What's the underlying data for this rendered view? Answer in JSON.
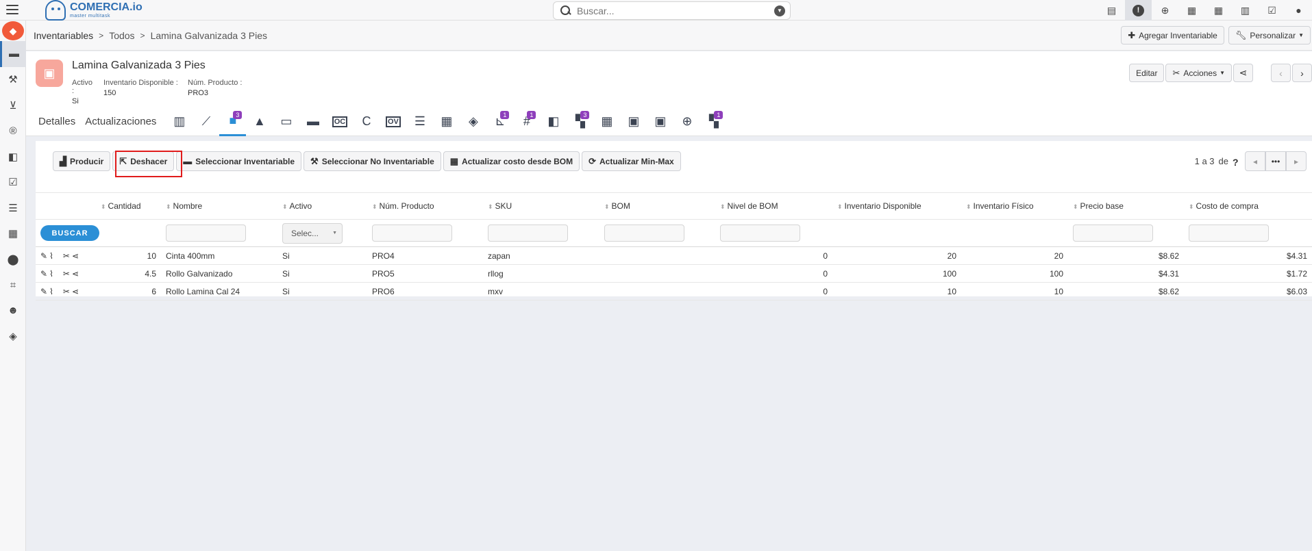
{
  "app": {
    "brand": "COMERCIA.io",
    "tagline": "master multitask"
  },
  "search": {
    "placeholder": "Buscar..."
  },
  "top_icons": [
    "cash-register-icon",
    "alert-icon",
    "plus-circle-icon",
    "calendar-check-icon",
    "calendar-icon",
    "chart-icon",
    "checkbox-icon",
    "user-icon"
  ],
  "sidebar": {
    "items": [
      "boxes-icon",
      "hammer-icon",
      "cart-icon",
      "registered-icon",
      "swatches-icon",
      "checkbox-icon",
      "list-icon",
      "calculator-icon",
      "map-pin-icon",
      "vector-icon",
      "users-icon",
      "cube-icon"
    ]
  },
  "breadcrumb": {
    "items": [
      "Inventariables",
      "Todos",
      "Lamina Galvanizada 3 Pies"
    ]
  },
  "crumb_actions": {
    "add": "Agregar Inventariable",
    "customize": "Personalizar"
  },
  "record": {
    "title": "Lamina Galvanizada 3 Pies",
    "fields": [
      {
        "label": "Activo :",
        "value": "Si"
      },
      {
        "label": "Inventario Disponible :",
        "value": "150"
      },
      {
        "label": "Núm. Producto :",
        "value": "PRO3"
      }
    ],
    "actions": {
      "edit": "Editar",
      "actions": "Acciones"
    }
  },
  "tabs": {
    "text": [
      "Detalles",
      "Actualizaciones"
    ],
    "icons": [
      {
        "name": "bar-chart-icon",
        "glyph": "▥",
        "badge": ""
      },
      {
        "name": "line-chart-icon",
        "glyph": "⟋",
        "badge": ""
      },
      {
        "name": "boxes-icon",
        "glyph": "■",
        "badge": "3",
        "active": true
      },
      {
        "name": "shapes-icon",
        "glyph": "▲",
        "badge": ""
      },
      {
        "name": "ticket-icon",
        "glyph": "▭",
        "badge": ""
      },
      {
        "name": "folder-icon",
        "glyph": "▬",
        "badge": ""
      },
      {
        "name": "oc-icon",
        "glyph": "OC",
        "badge": ""
      },
      {
        "name": "c-doc-icon",
        "glyph": "C",
        "badge": ""
      },
      {
        "name": "ov-icon",
        "glyph": "OV",
        "badge": ""
      },
      {
        "name": "list-icon",
        "glyph": "☰",
        "badge": ""
      },
      {
        "name": "calculator-icon",
        "glyph": "▦",
        "badge": ""
      },
      {
        "name": "box-open-icon",
        "glyph": "◈",
        "badge": ""
      },
      {
        "name": "dolly-icon",
        "glyph": "⊾",
        "badge": "1"
      },
      {
        "name": "hashtag-icon",
        "glyph": "#",
        "badge": "1"
      },
      {
        "name": "swatches-icon",
        "glyph": "◧",
        "badge": ""
      },
      {
        "name": "cubes-icon",
        "glyph": "▚",
        "badge": "3"
      },
      {
        "name": "calculator2-icon",
        "glyph": "▦",
        "badge": ""
      },
      {
        "name": "briefcase-icon",
        "glyph": "▣",
        "badge": ""
      },
      {
        "name": "briefcase2-icon",
        "glyph": "▣",
        "badge": ""
      },
      {
        "name": "cart-plus-icon",
        "glyph": "⊕",
        "badge": ""
      },
      {
        "name": "cubes-calc-icon",
        "glyph": "▚",
        "badge": "1"
      }
    ]
  },
  "toolbar": {
    "producir": "Producir",
    "deshacer": "Deshacer",
    "sel_inv": "Seleccionar Inventariable",
    "sel_no_inv": "Seleccionar No Inventariable",
    "act_bom": "Actualizar costo desde BOM",
    "act_minmax": "Actualizar Min-Max"
  },
  "pager": {
    "info": "1 a 3",
    "de": "de",
    "help": "?"
  },
  "table": {
    "headers": [
      "Cantidad",
      "Nombre",
      "Activo",
      "Núm. Producto",
      "SKU",
      "BOM",
      "Nivel de BOM",
      "Inventario Disponible",
      "Inventario Físico",
      "Precio base",
      "Costo de compra"
    ],
    "buscar": "BUSCAR",
    "select_placeholder": "Selec...",
    "rows": [
      {
        "cantidad": "10",
        "nombre": "Cinta 400mm",
        "activo": "Si",
        "num": "PRO4",
        "sku": "zapan",
        "bom": "",
        "nivel": "0",
        "disp": "20",
        "fisico": "20",
        "precio": "$8.62",
        "costo": "$4.31"
      },
      {
        "cantidad": "4.5",
        "nombre": "Rollo Galvanizado",
        "activo": "Si",
        "num": "PRO5",
        "sku": "rllog",
        "bom": "",
        "nivel": "0",
        "disp": "100",
        "fisico": "100",
        "precio": "$4.31",
        "costo": "$1.72"
      },
      {
        "cantidad": "6",
        "nombre": "Rollo Lamina Cal 24",
        "activo": "Si",
        "num": "PRO6",
        "sku": "mxv",
        "bom": "",
        "nivel": "0",
        "disp": "10",
        "fisico": "10",
        "precio": "$8.62",
        "costo": "$6.03"
      }
    ]
  }
}
